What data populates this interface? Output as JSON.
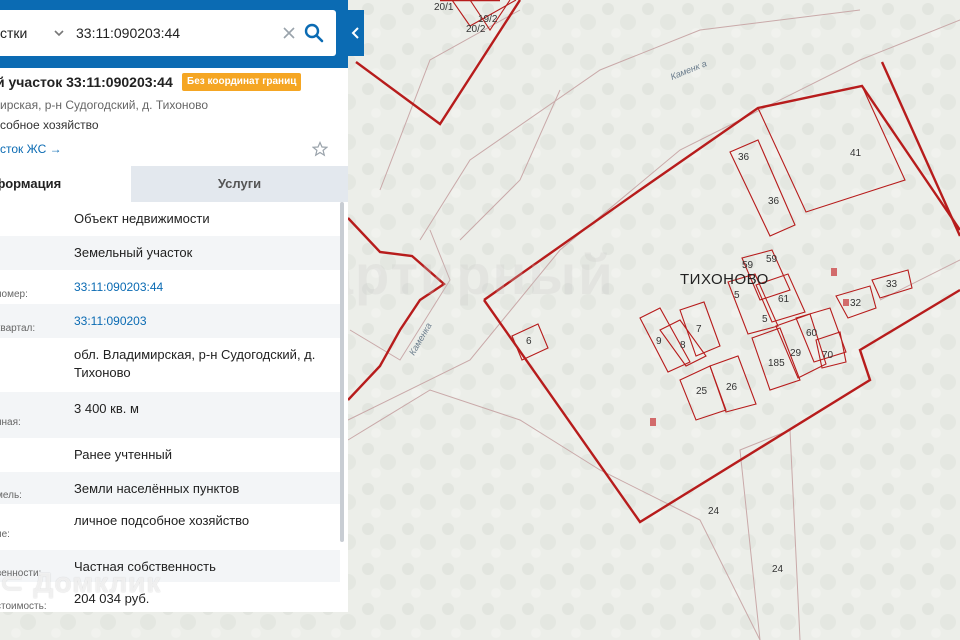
{
  "search": {
    "type_label": "стки",
    "value": "33:11:090203:44"
  },
  "parcel": {
    "title": "й участок 33:11:090203:44",
    "badge": "Без координат границ",
    "address_short": "ирская, р-н Судогодский, д. Тихоново",
    "use_short": "собное хозяйство",
    "zhs_link": "сток ЖС →"
  },
  "tabs": {
    "info": "формация",
    "services": "Услуги"
  },
  "rows": [
    {
      "label": "",
      "value": "Объект недвижимости"
    },
    {
      "label": "",
      "value": "Земельный участок"
    },
    {
      "label": "номер:",
      "value": "33:11:090203:44",
      "link": true
    },
    {
      "label": "квартал:",
      "value": "33:11:090203",
      "link": true
    },
    {
      "label": "",
      "value": "обл. Владимирская, р-н Судогодский, д. Тихоново"
    },
    {
      "label": "нная:",
      "value": "3 400 кв. м"
    },
    {
      "label": "",
      "value": "Ранее учтенный"
    },
    {
      "label": "мель:",
      "value": "Земли населённых пунктов"
    },
    {
      "label": "ие:",
      "value": "личное подсобное хозяйство"
    },
    {
      "label": "венности:",
      "value": "Частная собственность"
    },
    {
      "label": "стоимость:",
      "value": "204 034 руб."
    }
  ],
  "watermark": "Домклик",
  "map": {
    "place_name": "ТИХОНОВО",
    "streets": [
      "Каменк а",
      "Каменка"
    ],
    "plot_numbers": [
      "20/1",
      "19/2",
      "20/2",
      "41",
      "36",
      "36",
      "59",
      "59",
      "5",
      "61",
      "5",
      "33",
      "32",
      "9",
      "8",
      "7",
      "185",
      "60",
      "29",
      "70",
      "25",
      "26",
      "24",
      "24",
      "6"
    ],
    "accent_color": "#b71c1c"
  }
}
